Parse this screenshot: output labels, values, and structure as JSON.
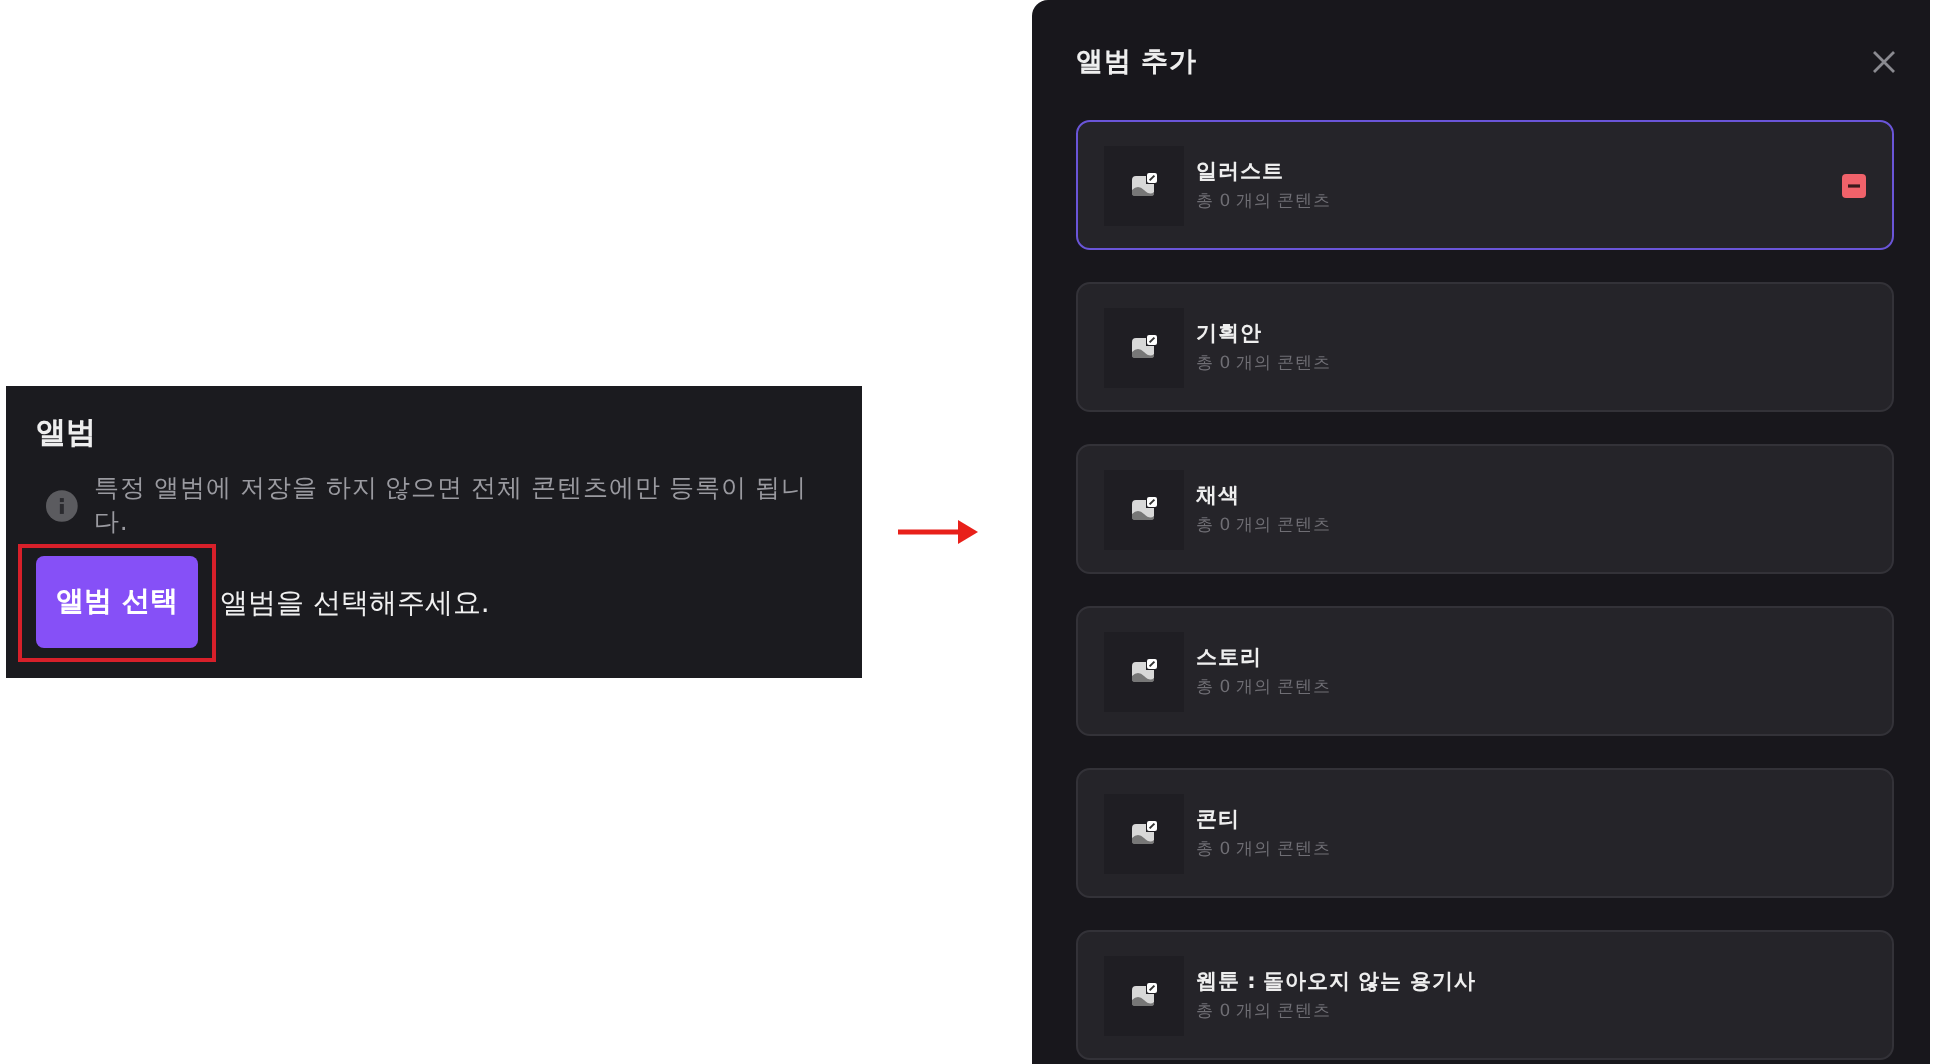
{
  "album_section": {
    "title": "앨범",
    "notice": "특정 앨범에 저장을 하지 않으면 전체 콘텐츠에만 등록이 됩니다.",
    "select_button": "앨범 선택",
    "hint": "앨범을 선택해주세요."
  },
  "modal": {
    "title": "앨범 추가",
    "albums": [
      {
        "name": "일러스트",
        "count": "총 0 개의 콘텐츠",
        "selected": true
      },
      {
        "name": "기획안",
        "count": "총 0 개의 콘텐츠",
        "selected": false
      },
      {
        "name": "채색",
        "count": "총 0 개의 콘텐츠",
        "selected": false
      },
      {
        "name": "스토리",
        "count": "총 0 개의 콘텐츠",
        "selected": false
      },
      {
        "name": "콘티",
        "count": "총 0 개의 콘텐츠",
        "selected": false
      },
      {
        "name": "웹툰 : 돌아오지 않는 용기사",
        "count": "총 0 개의 콘텐츠",
        "selected": false
      }
    ]
  }
}
